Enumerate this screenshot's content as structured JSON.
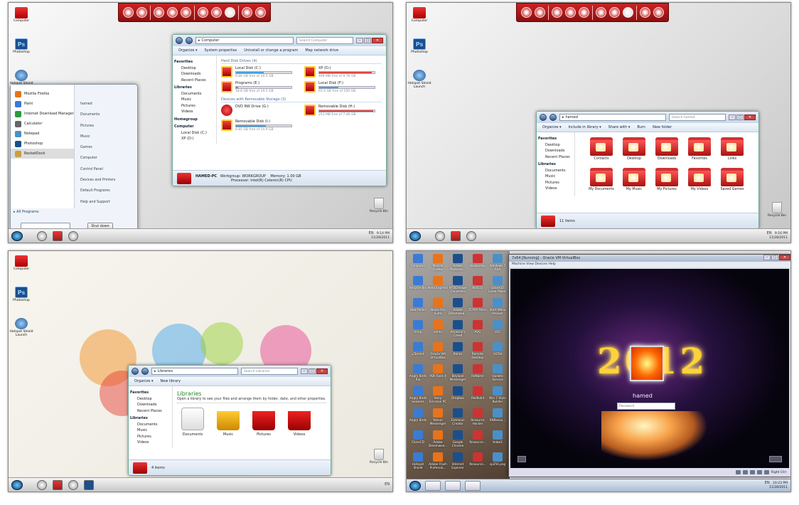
{
  "q1": {
    "desktop_icons": [
      {
        "label": "Computer"
      },
      {
        "label": "Photoshop"
      },
      {
        "label": "Hotspot Shield Launch"
      }
    ],
    "recycle_label": "Recycle Bin",
    "explorer": {
      "address": "Computer",
      "search_placeholder": "Search Computer",
      "toolbar": [
        "Organize ▾",
        "System properties",
        "Uninstall or change a program",
        "Map network drive"
      ],
      "nav": [
        {
          "text": "Favorites",
          "h": true
        },
        {
          "text": "Desktop"
        },
        {
          "text": "Downloads"
        },
        {
          "text": "Recent Places"
        },
        {
          "text": "Libraries",
          "h": true
        },
        {
          "text": "Documents"
        },
        {
          "text": "Music"
        },
        {
          "text": "Pictures"
        },
        {
          "text": "Videos"
        },
        {
          "text": "Homegroup",
          "h": true
        },
        {
          "text": "Computer",
          "h": true
        },
        {
          "text": "Local Disk (C:)"
        },
        {
          "text": "XP (D:)"
        }
      ],
      "section_hdd": "Hard Disk Drives (4)",
      "drives": [
        {
          "name": "Local Disk (C:)",
          "free": "9.66 GB free of 19.5 GB",
          "used": 0.5
        },
        {
          "name": "XP (D:)",
          "free": "499 MB free of 9.76 GB",
          "used": 0.95
        },
        {
          "name": "Programs (E:)",
          "free": "18.8 GB free of 19.5 GB",
          "used": 0.04
        },
        {
          "name": "Local Disk (F:)",
          "free": "65.4 GB free of 100 GB",
          "used": 0.35
        }
      ],
      "section_removable": "Devices with Removable Storage (3)",
      "removable": [
        {
          "name": "DVD RW Drive (G:)",
          "free": "",
          "used": 0
        },
        {
          "name": "Removable Disk (H:)",
          "free": "253 MB free of 7.46 GB",
          "used": 0.97
        },
        {
          "name": "Removable Disk (I:)",
          "free": "6.81 GB free of 14.9 GB",
          "used": 0.54
        }
      ],
      "status_pc": "HAMED-PC",
      "status_workgroup": "Workgroup: WORKGROUP",
      "status_memory": "Memory: 1.00 GB",
      "status_processor": "Processor: Intel(R) Celeron(R) CPU"
    },
    "startmenu": {
      "left_items": [
        {
          "label": "Mozilla Firefox",
          "color": "#e8731a"
        },
        {
          "label": "Paint",
          "color": "#3a7bd5"
        },
        {
          "label": "Internet Download Manager",
          "color": "#2a9d3a"
        },
        {
          "label": "Calculator",
          "color": "#666666"
        },
        {
          "label": "Notepad",
          "color": "#4a90c8"
        },
        {
          "label": "Photoshop",
          "color": "#1b4f8c"
        },
        {
          "label": "RocketDock",
          "color": "#c8a040"
        }
      ],
      "right_items": [
        "hamed",
        "Documents",
        "Pictures",
        "Music",
        "Games",
        "Computer",
        "Control Panel",
        "Devices and Printers",
        "Default Programs",
        "Help and Support"
      ],
      "all_programs": "All Programs",
      "shutdown": "Shut down"
    },
    "clock_time": "9:14 PM",
    "clock_date": "11/28/2011",
    "lang": "EN"
  },
  "q2": {
    "desktop_icons": [
      {
        "label": "Computer"
      },
      {
        "label": "Photoshop"
      },
      {
        "label": "Hotspot Shield Launch"
      }
    ],
    "recycle_label": "Recycle Bin",
    "explorer": {
      "address": "hamed",
      "search_placeholder": "Search hamed",
      "toolbar": [
        "Organize ▾",
        "Include in library ▾",
        "Share with ▾",
        "Burn",
        "New folder"
      ],
      "nav": [
        {
          "text": "Favorites",
          "h": true
        },
        {
          "text": "Desktop"
        },
        {
          "text": "Downloads"
        },
        {
          "text": "Recent Places"
        },
        {
          "text": "Libraries",
          "h": true
        },
        {
          "text": "Documents"
        },
        {
          "text": "Music"
        },
        {
          "text": "Pictures"
        },
        {
          "text": "Videos"
        }
      ],
      "folders": [
        "Contacts",
        "Desktop",
        "Downloads",
        "Favorites",
        "Links",
        "My Documents",
        "My Music",
        "My Pictures",
        "My Videos",
        "Saved Games"
      ],
      "status": "11 items"
    },
    "clock_time": "9:16 PM",
    "clock_date": "11/28/2011",
    "lang": "EN"
  },
  "q3": {
    "desktop_icons": [
      {
        "label": "Computer"
      },
      {
        "label": "Photoshop"
      },
      {
        "label": "Hotspot Shield Launch"
      }
    ],
    "recycle_label": "Recycle Bin",
    "explorer": {
      "address": "Libraries",
      "search_placeholder": "Search Libraries",
      "toolbar": [
        "Organize ▾",
        "New library"
      ],
      "nav": [
        {
          "text": "Favorites",
          "h": true
        },
        {
          "text": "Desktop"
        },
        {
          "text": "Downloads"
        },
        {
          "text": "Recent Places"
        },
        {
          "text": "Libraries",
          "h": true
        },
        {
          "text": "Documents"
        },
        {
          "text": "Music"
        },
        {
          "text": "Pictures"
        },
        {
          "text": "Videos"
        }
      ],
      "heading": "Libraries",
      "subheading": "Open a library to see your files and arrange them by folder, date, and other properties.",
      "libs": [
        {
          "label": "Documents"
        },
        {
          "label": "Music"
        },
        {
          "label": "Pictures"
        },
        {
          "label": "Videos"
        }
      ],
      "status": "4 items"
    },
    "lang": "EN"
  },
  "q4": {
    "desktop_icons": [
      "Computer",
      "Mozilla Firefox",
      "Adobe Photosho...",
      "Kaspersky",
      "Windows 7 RSS",
      "Recycle Bin",
      "Nero Express",
      "NTSCImage Converter",
      "NOD32",
      "Ghost32 Lover Maker",
      "New folder",
      "Nokia Ovi Suite",
      "Adobe Dreamwea...",
      "TCP/IP Patch",
      "Start Menu Reviver",
      "temp",
      "sdrev",
      "Assassin's Creed",
      "AVG",
      "VLC",
      "µTorrent",
      "Oracle VM VirtualBox",
      "Baran",
      "Remote Desktop",
      "ULTRA",
      "Angry Birds Rio",
      "PDF-Tools 4",
      "Beyluxe Messenger",
      "ReName",
      "Update Service",
      "Angry Birds Seasons",
      "Sony Ericsson PC",
      "Dropbox",
      "ResBuild",
      "Win 7 Style Builder",
      "Angry Birds",
      "Yahoo! Messenger",
      "Ezemous Creator",
      "Resource Hacker",
      "XNResou...",
      "CloneCD",
      "Adobe Dreamwea...",
      "Google Chrome",
      "Resource...",
      "Hobe2",
      "Hotspot Shield",
      "Adobe Flash Professio...",
      "Internet Explorer",
      "Resource...",
      "sp256.png"
    ],
    "vbox_title": "7x64 [Running] - Oracle VM VirtualBox",
    "vbox_menu": "Machine   View   Devices   Help",
    "big_text": "2012",
    "username": "hamed",
    "password_placeholder": "Password",
    "right_ctrl": "Right Ctrl",
    "clock_time": "10:23 PM",
    "clock_date": "11/28/2011",
    "lang": "EN"
  }
}
